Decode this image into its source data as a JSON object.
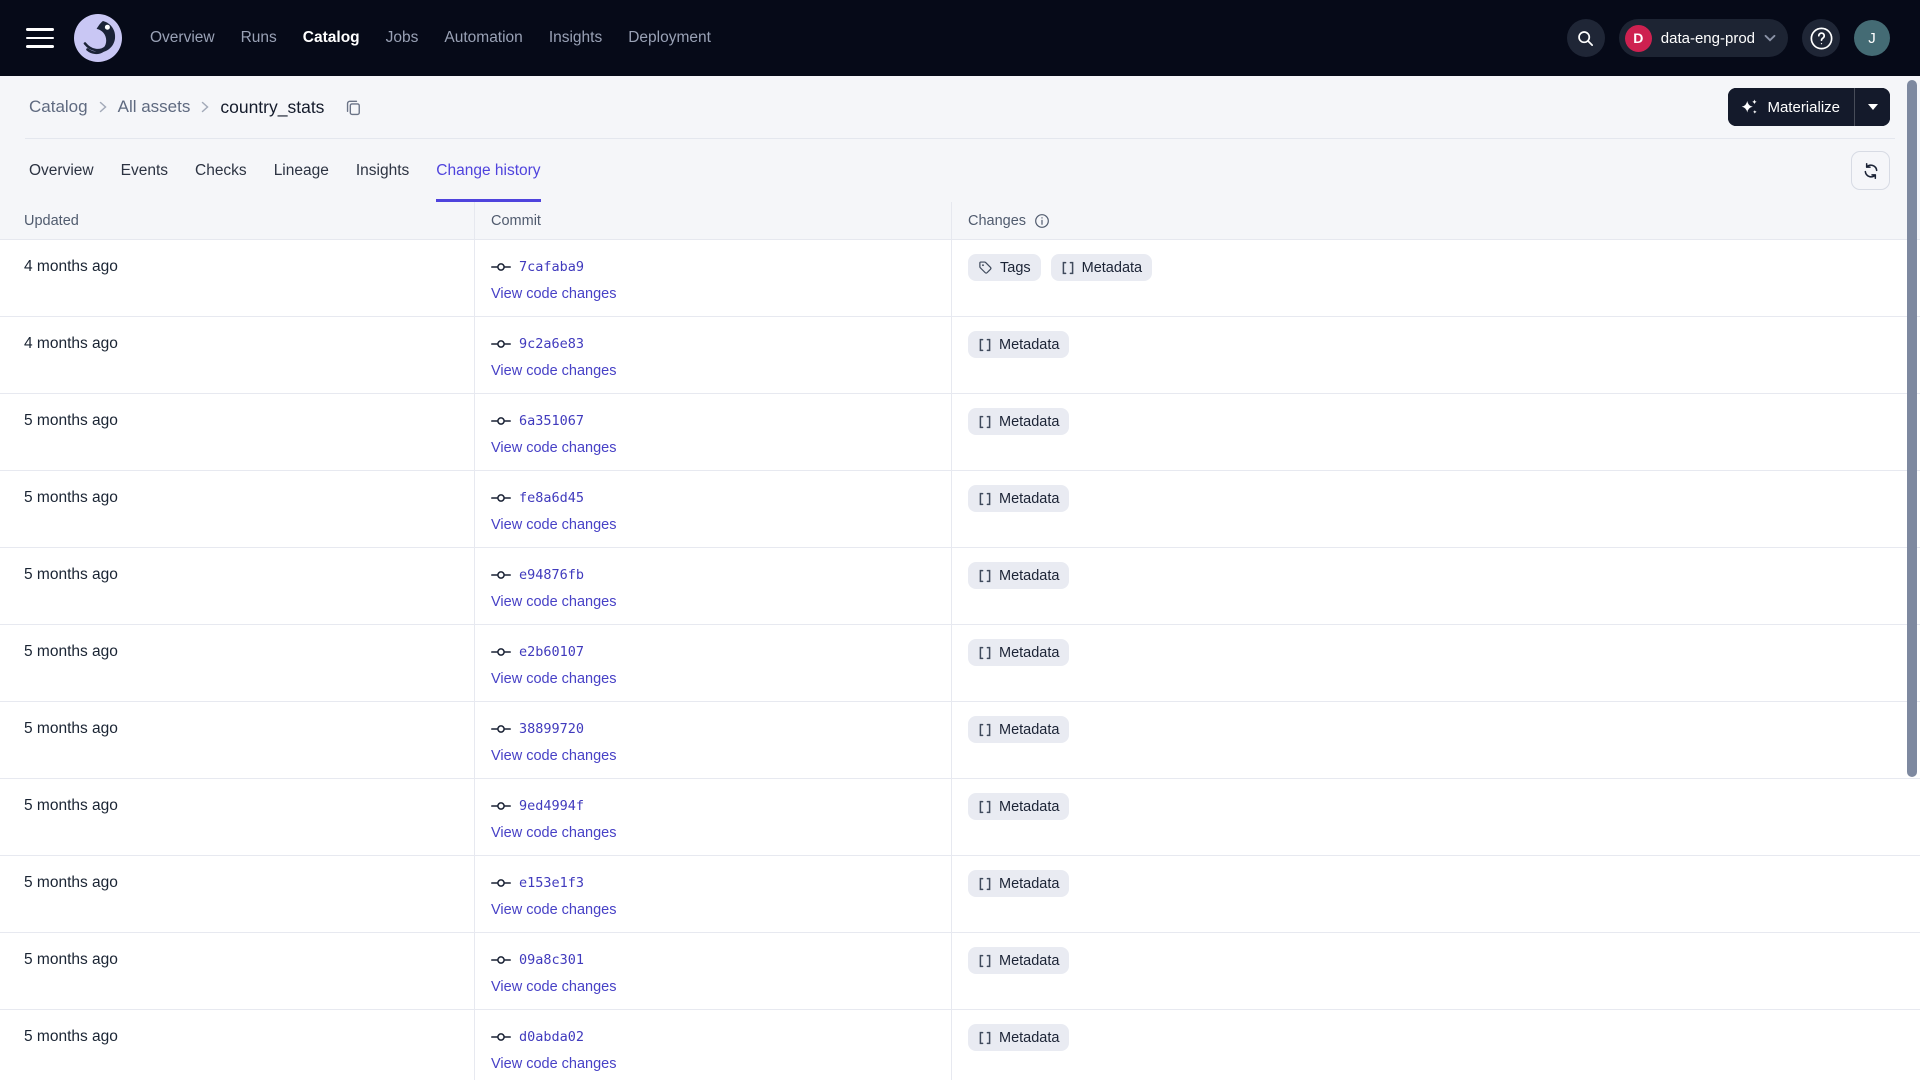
{
  "topnav": {
    "items": [
      {
        "label": "Overview",
        "active": false
      },
      {
        "label": "Runs",
        "active": false
      },
      {
        "label": "Catalog",
        "active": true
      },
      {
        "label": "Jobs",
        "active": false
      },
      {
        "label": "Automation",
        "active": false
      },
      {
        "label": "Insights",
        "active": false
      },
      {
        "label": "Deployment",
        "active": false
      }
    ],
    "deployment": {
      "initial": "D",
      "name": "data-eng-prod"
    },
    "avatar_initial": "J"
  },
  "breadcrumb": {
    "items": [
      "Catalog",
      "All assets"
    ],
    "current": "country_stats"
  },
  "actions": {
    "materialize_label": "Materialize"
  },
  "tabs": [
    {
      "label": "Overview",
      "active": false
    },
    {
      "label": "Events",
      "active": false
    },
    {
      "label": "Checks",
      "active": false
    },
    {
      "label": "Lineage",
      "active": false
    },
    {
      "label": "Insights",
      "active": false
    },
    {
      "label": "Change history",
      "active": true
    }
  ],
  "table": {
    "columns": [
      "Updated",
      "Commit",
      "Changes"
    ],
    "view_code_changes_label": "View code changes",
    "rows": [
      {
        "updated": "4 months ago",
        "commit": "7cafaba9",
        "changes": [
          {
            "label": "Tags",
            "icon": "tag-icon"
          },
          {
            "label": "Metadata",
            "icon": "brackets-icon"
          }
        ]
      },
      {
        "updated": "4 months ago",
        "commit": "9c2a6e83",
        "changes": [
          {
            "label": "Metadata",
            "icon": "brackets-icon"
          }
        ]
      },
      {
        "updated": "5 months ago",
        "commit": "6a351067",
        "changes": [
          {
            "label": "Metadata",
            "icon": "brackets-icon"
          }
        ]
      },
      {
        "updated": "5 months ago",
        "commit": "fe8a6d45",
        "changes": [
          {
            "label": "Metadata",
            "icon": "brackets-icon"
          }
        ]
      },
      {
        "updated": "5 months ago",
        "commit": "e94876fb",
        "changes": [
          {
            "label": "Metadata",
            "icon": "brackets-icon"
          }
        ]
      },
      {
        "updated": "5 months ago",
        "commit": "e2b60107",
        "changes": [
          {
            "label": "Metadata",
            "icon": "brackets-icon"
          }
        ]
      },
      {
        "updated": "5 months ago",
        "commit": "38899720",
        "changes": [
          {
            "label": "Metadata",
            "icon": "brackets-icon"
          }
        ]
      },
      {
        "updated": "5 months ago",
        "commit": "9ed4994f",
        "changes": [
          {
            "label": "Metadata",
            "icon": "brackets-icon"
          }
        ]
      },
      {
        "updated": "5 months ago",
        "commit": "e153e1f3",
        "changes": [
          {
            "label": "Metadata",
            "icon": "brackets-icon"
          }
        ]
      },
      {
        "updated": "5 months ago",
        "commit": "09a8c301",
        "changes": [
          {
            "label": "Metadata",
            "icon": "brackets-icon"
          }
        ]
      },
      {
        "updated": "5 months ago",
        "commit": "d0abda02",
        "changes": [
          {
            "label": "Metadata",
            "icon": "brackets-icon"
          }
        ]
      }
    ]
  },
  "icons": {
    "menu-icon": "hamburger",
    "dagster-logo": "octopus swirl",
    "search-icon": "magnifier",
    "chevron-down-icon": "v",
    "help-icon": "? in circle",
    "copy-icon": "two sheets",
    "sparkle-icon": "four-point star",
    "caret-down-icon": "filled triangle",
    "refresh-icon": "circular arrows",
    "info-icon": "i in circle",
    "commit-icon": "circle with side lines",
    "tag-icon": "price tag",
    "brackets-icon": "[ ]"
  },
  "colors": {
    "nav_bg": "#060A18",
    "accent": "#4F43DD",
    "link": "#4741C6",
    "badge_bg": "#E9EBF2",
    "deployment_badge": "#CE2150",
    "avatar_bg": "#446B74",
    "row_border": "#E7E9F0",
    "scrollbar": "#7E89A0",
    "dark_button": "#141A2B"
  }
}
